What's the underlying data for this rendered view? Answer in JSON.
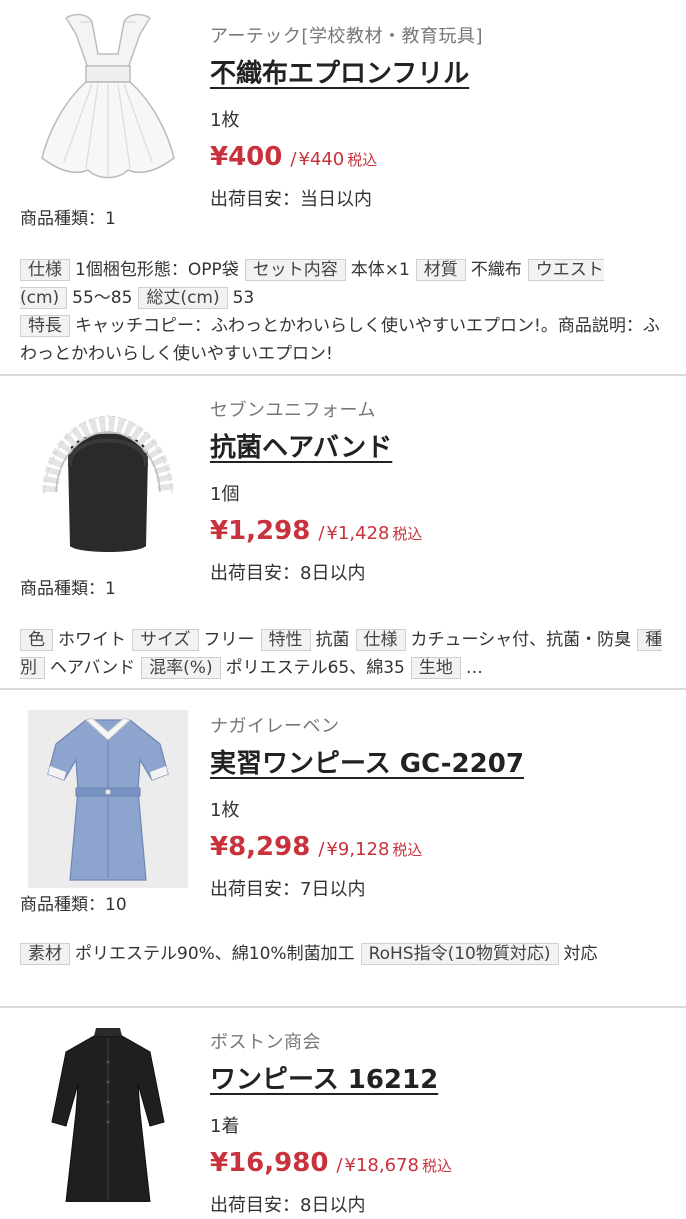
{
  "products": [
    {
      "brand": "アーテック[学校教材・教育玩具]",
      "name": "不織布エプロンフリル",
      "unit": "1枚",
      "price": "¥400",
      "tax_price": "¥440",
      "tax_label": "税込",
      "shipping": "出荷目安：当日以内",
      "kinds": "商品種類：1",
      "spec_1_label": "仕様",
      "spec_1_value": "1個梱包形態：OPP袋",
      "spec_2_label": "セット内容",
      "spec_2_value": "本体×1",
      "spec_3_label": "材質",
      "spec_3_value": "不織布",
      "spec_4_label": "ウエスト(cm)",
      "spec_4_value": "55〜85",
      "spec_5_label": "総丈(cm)",
      "spec_5_value": "53",
      "spec_6_label": "特長",
      "spec_6_value": "キャッチコピー：ふわっとかわいらしく使いやすいエプロン!。商品説明：ふわっとかわいらしく使いやすいエプロン!"
    },
    {
      "brand": "セブンユニフォーム",
      "name": "抗菌ヘアバンド",
      "unit": "1個",
      "price": "¥1,298",
      "tax_price": "¥1,428",
      "tax_label": "税込",
      "shipping": "出荷目安：8日以内",
      "kinds": "商品種類：1",
      "spec_1_label": "色",
      "spec_1_value": "ホワイト",
      "spec_2_label": "サイズ",
      "spec_2_value": "フリー",
      "spec_3_label": "特性",
      "spec_3_value": "抗菌",
      "spec_4_label": "仕様",
      "spec_4_value": "カチューシャ付、抗菌・防臭",
      "spec_5_label": "種別",
      "spec_5_value": "ヘアバンド",
      "spec_6_label": "混率(%)",
      "spec_6_value": "ポリエステル65、綿35",
      "spec_7_label": "生地",
      "spec_7_value": "…"
    },
    {
      "brand": "ナガイレーベン",
      "name": "実習ワンピース GC-2207",
      "unit": "1枚",
      "price": "¥8,298",
      "tax_price": "¥9,128",
      "tax_label": "税込",
      "shipping": "出荷目安：7日以内",
      "kinds": "商品種類：10",
      "spec_1_label": "素材",
      "spec_1_value": "ポリエステル90%、綿10%制菌加工",
      "spec_2_label": "RoHS指令(10物質対応)",
      "spec_2_value": "対応"
    },
    {
      "brand": "ボストン商会",
      "name": "ワンピース 16212",
      "unit": "1着",
      "price": "¥16,980",
      "tax_price": "¥18,678",
      "tax_label": "税込",
      "shipping": "出荷目安：8日以内"
    }
  ],
  "colors": {
    "price": "#c8323c",
    "spec_label_bg": "#f2f2f2",
    "divider": "#d9d9d9"
  },
  "icons": [
    "apron-frill-image",
    "hairband-image",
    "nurse-dress-image",
    "black-dress-image"
  ]
}
